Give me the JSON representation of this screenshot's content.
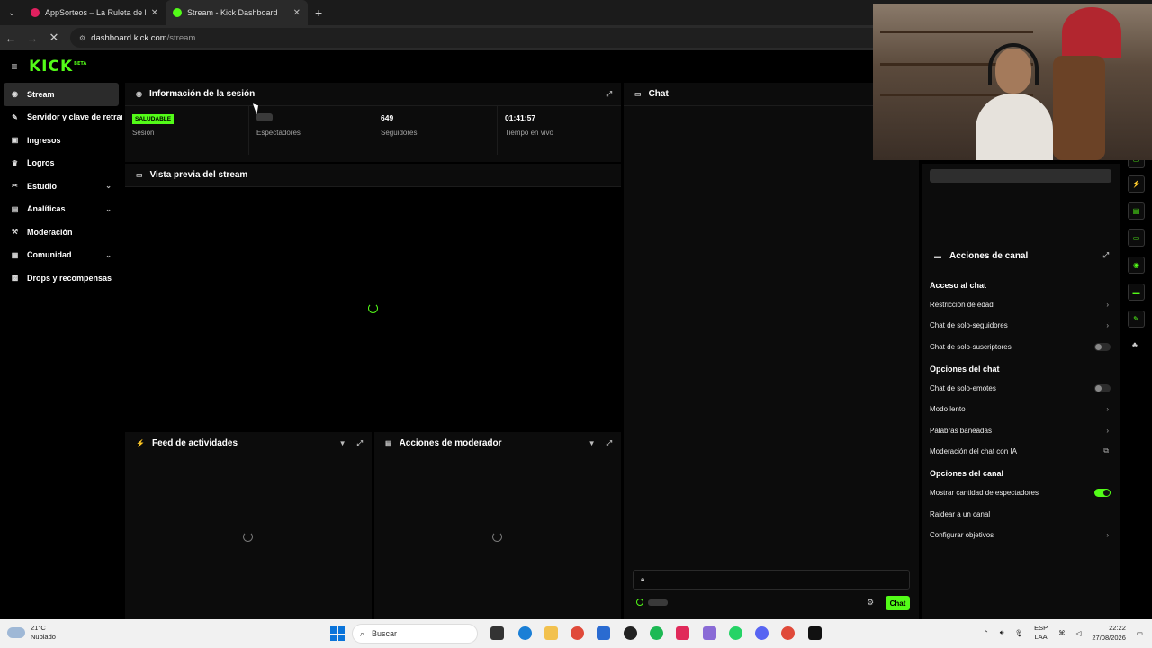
{
  "browser": {
    "tabs": [
      {
        "title": "AppSorteos – La Ruleta de la Su",
        "icon_color": "#e0205f"
      },
      {
        "title": "Stream - Kick Dashboard",
        "icon_color": "#53fc18"
      }
    ],
    "url_host": "dashboard.kick.com",
    "url_path": "/stream"
  },
  "kick": {
    "logo": "KICK",
    "beta": "BETA"
  },
  "sidebar": {
    "items": [
      {
        "label": "Stream",
        "icon": "record-icon"
      },
      {
        "label": "Servidor y clave de retransmisión",
        "icon": "wrench-icon"
      },
      {
        "label": "Ingresos",
        "icon": "wallet-icon"
      },
      {
        "label": "Logros",
        "icon": "trophy-icon"
      },
      {
        "label": "Estudio",
        "icon": "tools-icon"
      },
      {
        "label": "Analíticas",
        "icon": "chart-icon"
      },
      {
        "label": "Moderación",
        "icon": "hammer-icon"
      },
      {
        "label": "Comunidad",
        "icon": "community-icon"
      },
      {
        "label": "Drops y recompensas",
        "icon": "gift-icon"
      }
    ]
  },
  "session": {
    "title": "Información de la sesión",
    "status_badge": "SALUDABLE",
    "status_label": "Sesión",
    "viewers_label": "Espectadores",
    "followers_value": "649",
    "followers_label": "Seguidores",
    "live_time_value": "01:41:57",
    "live_time_label": "Tiempo en vivo"
  },
  "preview": {
    "title": "Vista previa del stream"
  },
  "activity": {
    "title": "Feed de actividades"
  },
  "mod_actions": {
    "title": "Acciones de moderador"
  },
  "chat": {
    "title": "Chat",
    "send_label": "Chat"
  },
  "channel_actions": {
    "title": "Acciones de canal",
    "sections": [
      {
        "title": "Acceso al chat",
        "rows": [
          {
            "label": "Restricción de edad",
            "control": "chevron"
          },
          {
            "label": "Chat de solo-seguidores",
            "control": "chevron"
          },
          {
            "label": "Chat de solo-suscriptores",
            "control": "toggle-off"
          }
        ]
      },
      {
        "title": "Opciones del chat",
        "rows": [
          {
            "label": "Chat de solo-emotes",
            "control": "toggle-off"
          },
          {
            "label": "Modo lento",
            "control": "chevron"
          },
          {
            "label": "Palabras baneadas",
            "control": "chevron"
          },
          {
            "label": "Moderación del chat con IA",
            "control": "external"
          }
        ]
      },
      {
        "title": "Opciones del canal",
        "rows": [
          {
            "label": "Mostrar cantidad de espectadores",
            "control": "toggle-on"
          },
          {
            "label": "Raidear a un canal",
            "control": "none"
          },
          {
            "label": "Configurar objetivos",
            "control": "chevron"
          }
        ]
      }
    ]
  },
  "taskbar": {
    "weather_temp": "21°C",
    "weather_desc": "Nublado",
    "search_placeholder": "Buscar",
    "lang_1": "ESP",
    "lang_2": "LAA",
    "time": "22:22",
    "date": "27/08/2026"
  },
  "colors": {
    "accent": "#53fc18"
  }
}
